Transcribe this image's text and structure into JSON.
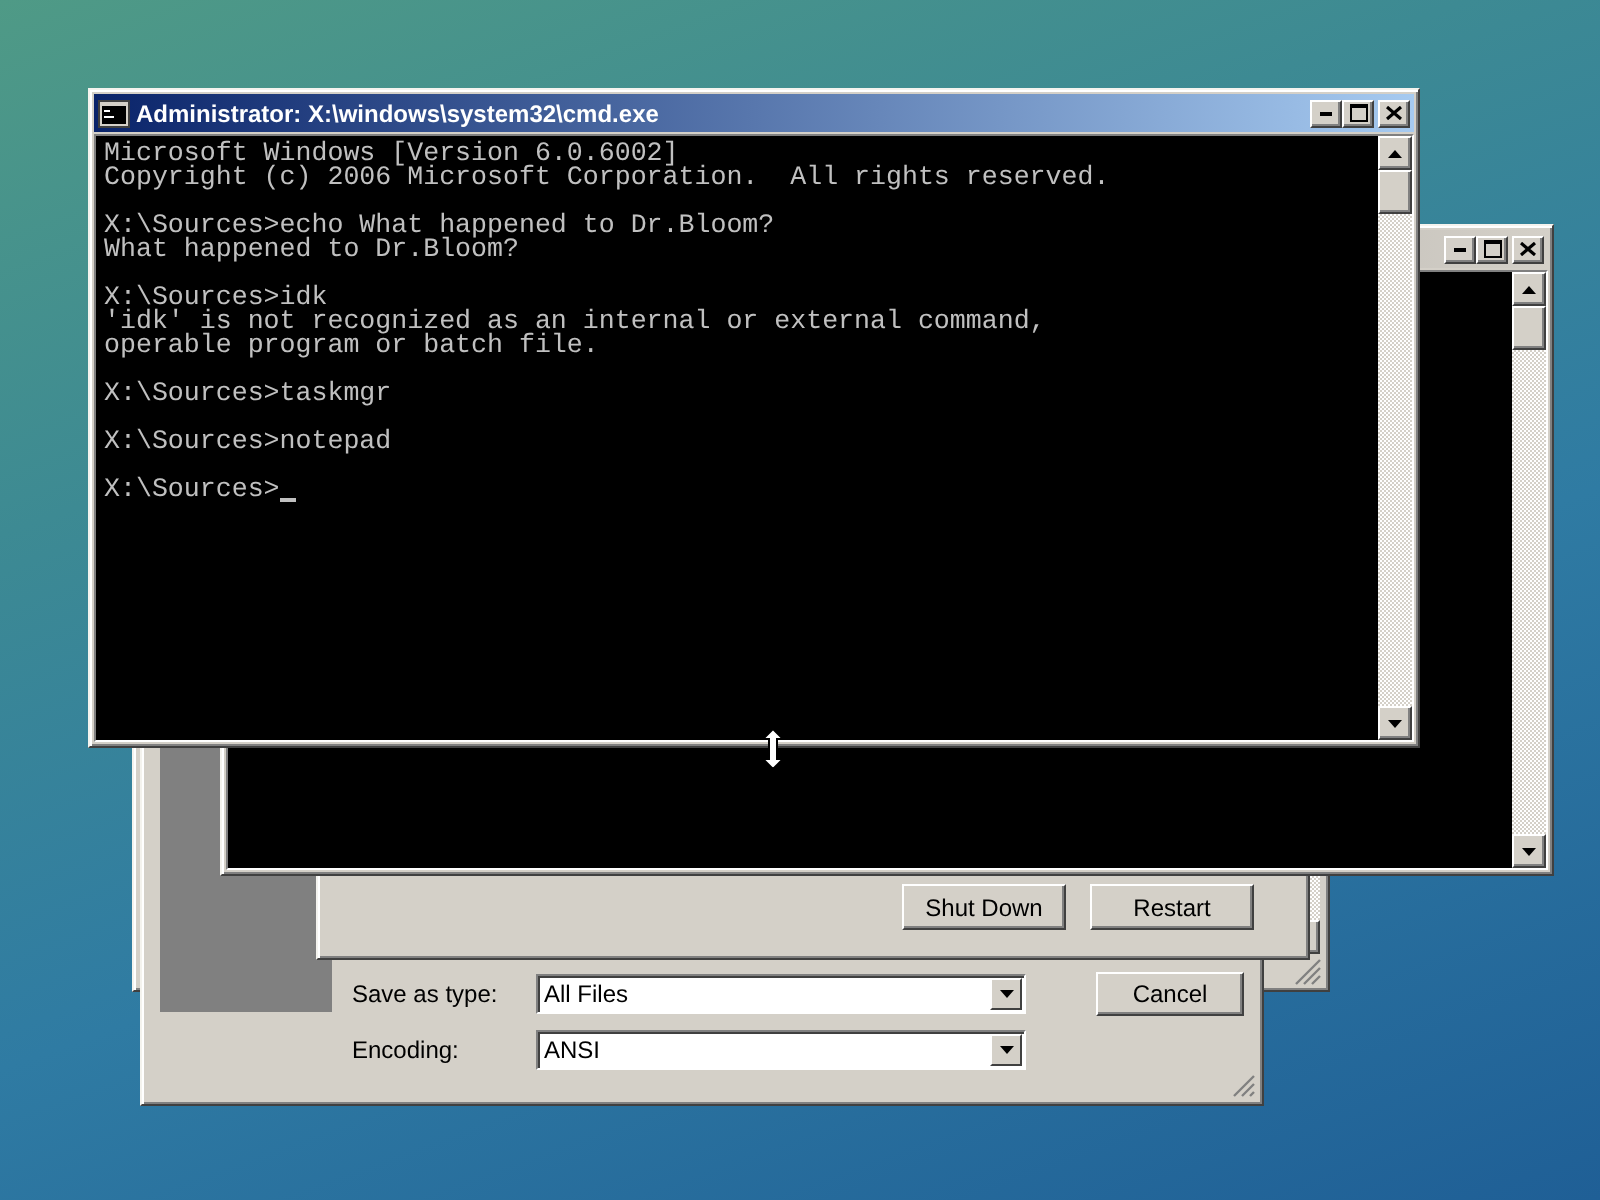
{
  "save_dialog": {
    "fields": [
      {
        "label": "Save as type:",
        "value": "All Files"
      },
      {
        "label": "Encoding:",
        "value": "ANSI"
      }
    ],
    "buttons": [
      "Cancel"
    ]
  },
  "shutdown_dialog": {
    "buttons": [
      "Shut Down",
      "Restart"
    ]
  },
  "console": {
    "title": "Administrator: X:\\windows\\system32\\cmd.exe",
    "active": true,
    "cursor": true,
    "blocks": [
      [
        "Microsoft Windows [Version 6.0.6002]",
        "Copyright (c) 2006 Microsoft Corporation.  All rights reserved."
      ],
      [
        "X:\\Sources>echo What happened to Dr.Bloom?",
        "What happened to Dr.Bloom?"
      ],
      [
        "X:\\Sources>idk",
        "'idk' is not recognized as an internal or external command,",
        "operable program or batch file."
      ],
      [
        "X:\\Sources>taskmgr"
      ],
      [
        "X:\\Sources>notepad"
      ],
      [
        "X:\\Sources>"
      ]
    ]
  }
}
